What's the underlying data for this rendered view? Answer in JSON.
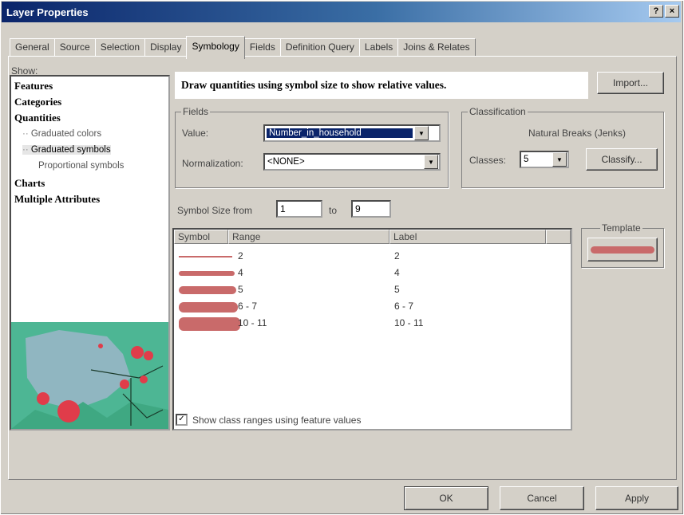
{
  "window": {
    "title": "Layer Properties",
    "help_button": "?",
    "close_button": "×"
  },
  "tabs": [
    {
      "label": "General"
    },
    {
      "label": "Source"
    },
    {
      "label": "Selection"
    },
    {
      "label": "Display"
    },
    {
      "label": "Symbology",
      "active": true
    },
    {
      "label": "Fields"
    },
    {
      "label": "Definition Query"
    },
    {
      "label": "Labels"
    },
    {
      "label": "Joins & Relates"
    }
  ],
  "show": {
    "label": "Show:",
    "items": [
      {
        "label": "Features",
        "type": "category"
      },
      {
        "label": "Categories",
        "type": "category"
      },
      {
        "label": "Quantities",
        "type": "category"
      },
      {
        "label": "Graduated colors",
        "type": "sub"
      },
      {
        "label": "Graduated symbols",
        "type": "sub",
        "selected": true
      },
      {
        "label": "Proportional symbols",
        "type": "sub"
      },
      {
        "label": "Charts",
        "type": "category"
      },
      {
        "label": "Multiple Attributes",
        "type": "category"
      }
    ]
  },
  "headline": "Draw quantities using symbol size to show relative values.",
  "import_button": "Import...",
  "fields": {
    "group_label": "Fields",
    "value_label": "Value:",
    "value_selected": "Number_in_household",
    "normalization_label": "Normalization:",
    "normalization_selected": "<NONE>"
  },
  "classification": {
    "group_label": "Classification",
    "method": "Natural Breaks (Jenks)",
    "classes_label": "Classes:",
    "classes_value": "5",
    "classify_button": "Classify..."
  },
  "symbol_size": {
    "label": "Symbol Size from",
    "from": "1",
    "to_label": "to",
    "to": "9"
  },
  "table": {
    "headers": {
      "symbol": "Symbol",
      "range": "Range",
      "label": "Label"
    },
    "rows": [
      {
        "range": "2",
        "label": "2",
        "symbol_size": 1
      },
      {
        "range": "4",
        "label": "4",
        "symbol_size": 3
      },
      {
        "range": "5",
        "label": "5",
        "symbol_size": 5
      },
      {
        "range": "6 - 7",
        "label": "6 - 7",
        "symbol_size": 7
      },
      {
        "range": "10 - 11",
        "label": "10 - 11",
        "symbol_size": 9
      }
    ]
  },
  "template": {
    "label": "Template",
    "color": "#c96a6a"
  },
  "checkbox": {
    "label": "Show class ranges using feature values",
    "checked": true
  },
  "buttons": {
    "ok": "OK",
    "cancel": "Cancel",
    "apply": "Apply"
  },
  "colors": {
    "symbol": "#c96a6a",
    "preview_land": "#4db694",
    "preview_point": "#e03c4a",
    "title_start": "#0a246a",
    "title_end": "#a6caf0"
  }
}
